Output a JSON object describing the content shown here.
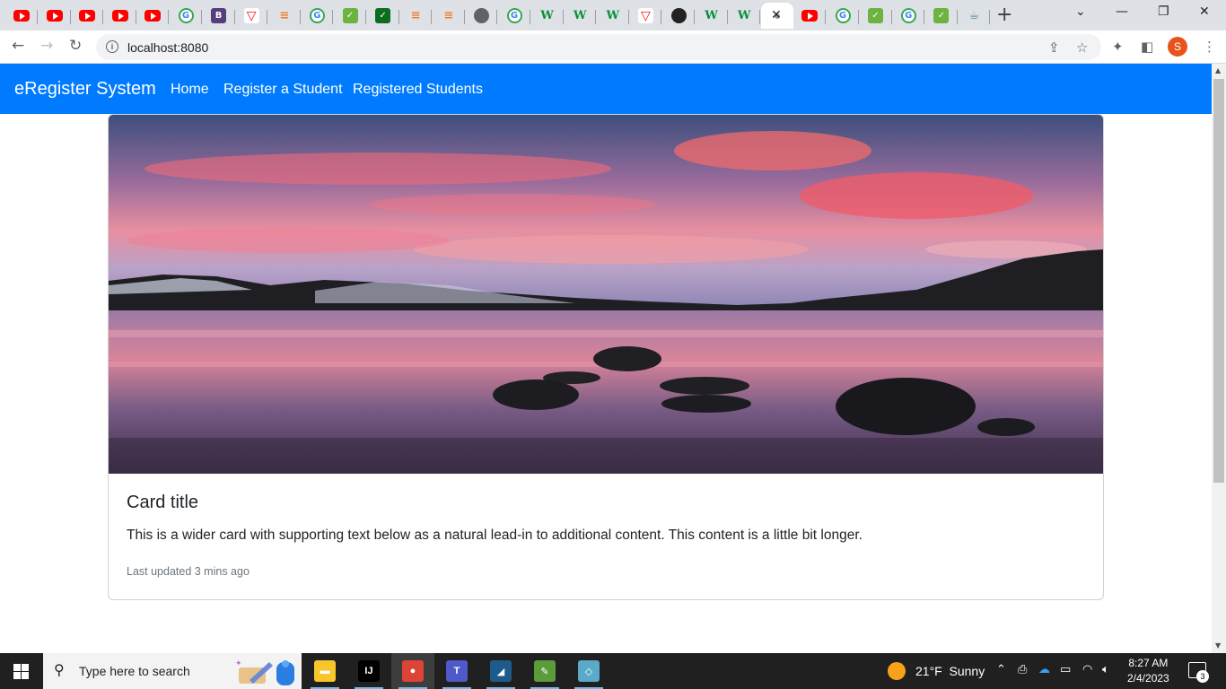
{
  "browser": {
    "tabs": [
      {
        "icon": "youtube-icon",
        "kind": "yt",
        "glyph": ""
      },
      {
        "icon": "youtube-icon",
        "kind": "yt",
        "glyph": ""
      },
      {
        "icon": "youtube-icon",
        "kind": "yt",
        "glyph": ""
      },
      {
        "icon": "youtube-icon",
        "kind": "yt",
        "glyph": ""
      },
      {
        "icon": "youtube-icon",
        "kind": "yt",
        "glyph": ""
      },
      {
        "icon": "google-icon",
        "kind": "g",
        "glyph": "G"
      },
      {
        "icon": "bootstrap-icon",
        "kind": "b",
        "glyph": "B"
      },
      {
        "icon": "vercel-icon",
        "kind": "v",
        "glyph": "▽"
      },
      {
        "icon": "stackoverflow-icon",
        "kind": "so",
        "glyph": "≡"
      },
      {
        "icon": "google-icon",
        "kind": "g",
        "glyph": "G"
      },
      {
        "icon": "spring-icon",
        "kind": "grn",
        "glyph": "✓"
      },
      {
        "icon": "spring-icon",
        "kind": "dk",
        "glyph": "✓"
      },
      {
        "icon": "stackoverflow-icon",
        "kind": "so",
        "glyph": "≡"
      },
      {
        "icon": "stackoverflow-icon",
        "kind": "so",
        "glyph": "≡"
      },
      {
        "icon": "globe-icon",
        "kind": "globe",
        "glyph": ""
      },
      {
        "icon": "google-icon",
        "kind": "g",
        "glyph": "G"
      },
      {
        "icon": "w-icon",
        "kind": "w",
        "glyph": "W"
      },
      {
        "icon": "w-icon",
        "kind": "w",
        "glyph": "W"
      },
      {
        "icon": "w-icon",
        "kind": "w",
        "glyph": "W"
      },
      {
        "icon": "vercel-icon",
        "kind": "v",
        "glyph": "▽"
      },
      {
        "icon": "github-icon",
        "kind": "blk",
        "glyph": ""
      },
      {
        "icon": "w-icon",
        "kind": "w",
        "glyph": "W"
      },
      {
        "icon": "w-icon",
        "kind": "w",
        "glyph": "W"
      },
      {
        "icon": "loading-icon",
        "kind": "dot",
        "glyph": "",
        "active": true
      },
      {
        "icon": "youtube-icon",
        "kind": "yt",
        "glyph": ""
      },
      {
        "icon": "google-icon",
        "kind": "g",
        "glyph": "G"
      },
      {
        "icon": "spring-icon",
        "kind": "grn",
        "glyph": "✓"
      },
      {
        "icon": "google-icon",
        "kind": "g",
        "glyph": "G"
      },
      {
        "icon": "spring-icon",
        "kind": "grn",
        "glyph": "✓"
      },
      {
        "icon": "java-icon",
        "kind": "java",
        "glyph": "☕"
      }
    ],
    "url": "localhost:8080",
    "profile_initial": "S"
  },
  "page": {
    "brand": "eRegister System",
    "nav": [
      {
        "label": "Home"
      },
      {
        "label": "Register a Student"
      },
      {
        "label": "Registered Students"
      }
    ],
    "card": {
      "title": "Card title",
      "text": "This is a wider card with supporting text below as a natural lead-in to additional content. This content is a little bit longer.",
      "updated": "Last updated 3 mins ago"
    }
  },
  "taskbar": {
    "search_placeholder": "Type here to search",
    "weather_temp": "21°F",
    "weather_desc": "Sunny",
    "time": "8:27 AM",
    "date": "2/4/2023",
    "notification_count": "3",
    "apps": [
      {
        "name": "file-explorer-icon",
        "color": "#f8c52b",
        "glyph": "▬"
      },
      {
        "name": "intellij-icon",
        "color": "#000000",
        "glyph": "IJ"
      },
      {
        "name": "chrome-icon",
        "color": "#db4437",
        "glyph": "●",
        "active": true
      },
      {
        "name": "teams-icon",
        "color": "#5059c9",
        "glyph": "T"
      },
      {
        "name": "mysql-workbench-icon",
        "color": "#1d5c8a",
        "glyph": "◢"
      },
      {
        "name": "notepad-icon",
        "color": "#5b9b3a",
        "glyph": "✎"
      },
      {
        "name": "snipping-tool-icon",
        "color": "#5aa9c8",
        "glyph": "◇"
      }
    ]
  },
  "colors": {
    "navbar": "#007bff",
    "taskbar": "#202020",
    "tabstrip": "#dee1e6"
  }
}
